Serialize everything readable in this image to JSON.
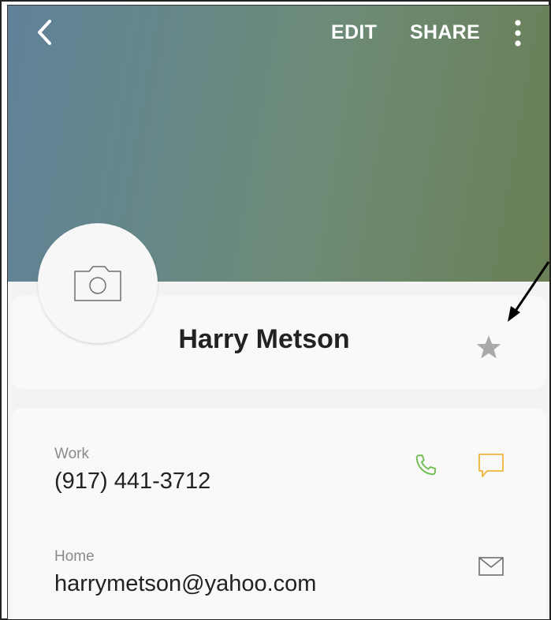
{
  "toolbar": {
    "back_icon": "chevron-left-icon",
    "edit_label": "EDIT",
    "share_label": "SHARE",
    "more_icon": "more-vertical-icon"
  },
  "contact": {
    "avatar_icon": "camera-icon",
    "name": "Harry Metson",
    "favorite_icon": "star-icon",
    "favorite": false
  },
  "details": [
    {
      "label": "Work",
      "value": "(917) 441-3712",
      "actions": [
        "phone-icon",
        "message-icon"
      ]
    },
    {
      "label": "Home",
      "value": "harrymetson@yahoo.com",
      "actions": [
        "mail-icon"
      ]
    }
  ],
  "colors": {
    "header_gradient": [
      "#5f8299",
      "#6c8b78",
      "#6a7f55"
    ],
    "call_green": "#6dbb4f",
    "message_yellow": "#f0b43a",
    "star_gray": "#a9a9a9",
    "card_bg": "#f9f9f9"
  },
  "annotation": {
    "icon": "annotation-arrow-icon"
  }
}
